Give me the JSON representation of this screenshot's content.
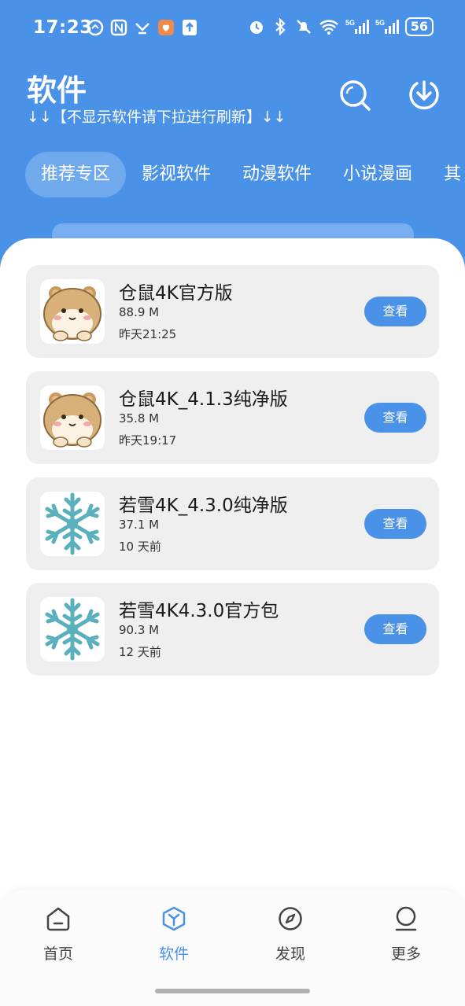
{
  "status_bar": {
    "time": "17:23",
    "battery": "56",
    "left_icons": [
      "speed-icon",
      "nfc-icon",
      "game-icon",
      "shield-app-icon",
      "upload-icon"
    ],
    "right_icons": [
      "alarm-icon",
      "bluetooth-icon",
      "mute-icon",
      "wifi-icon",
      "signal-5g-icon",
      "signal-5g-icon"
    ]
  },
  "header": {
    "title": "软件",
    "subtitle": "↓↓【不显示软件请下拉进行刷新】↓↓",
    "icons": [
      "search-icon",
      "download-icon"
    ]
  },
  "tabs": [
    {
      "label": "推荐专区",
      "active": true
    },
    {
      "label": "影视软件",
      "active": false
    },
    {
      "label": "动漫软件",
      "active": false
    },
    {
      "label": "小说漫画",
      "active": false
    },
    {
      "label": "其",
      "active": false
    }
  ],
  "apps": [
    {
      "name": "仓鼠4K官方版",
      "size": "88.9 M",
      "time": "昨天21:25",
      "icon": "hamster-icon",
      "action": "查看"
    },
    {
      "name": "仓鼠4K_4.1.3纯净版",
      "size": "35.8 M",
      "time": "昨天19:17",
      "icon": "hamster-icon",
      "action": "查看"
    },
    {
      "name": "若雪4K_4.3.0纯净版",
      "size": "37.1 M",
      "time": "10 天前",
      "icon": "snowflake-icon",
      "action": "查看"
    },
    {
      "name": "若雪4K4.3.0官方包",
      "size": "90.3 M",
      "time": "12 天前",
      "icon": "snowflake-icon",
      "action": "查看"
    }
  ],
  "bottom_nav": [
    {
      "label": "首页",
      "icon": "home-icon",
      "active": false
    },
    {
      "label": "软件",
      "icon": "cube-icon",
      "active": true
    },
    {
      "label": "发现",
      "icon": "compass-icon",
      "active": false
    },
    {
      "label": "更多",
      "icon": "user-icon",
      "active": false
    }
  ],
  "colors": {
    "primary": "#4a91e8",
    "card": "#efefef",
    "text": "#1a1a1a"
  }
}
